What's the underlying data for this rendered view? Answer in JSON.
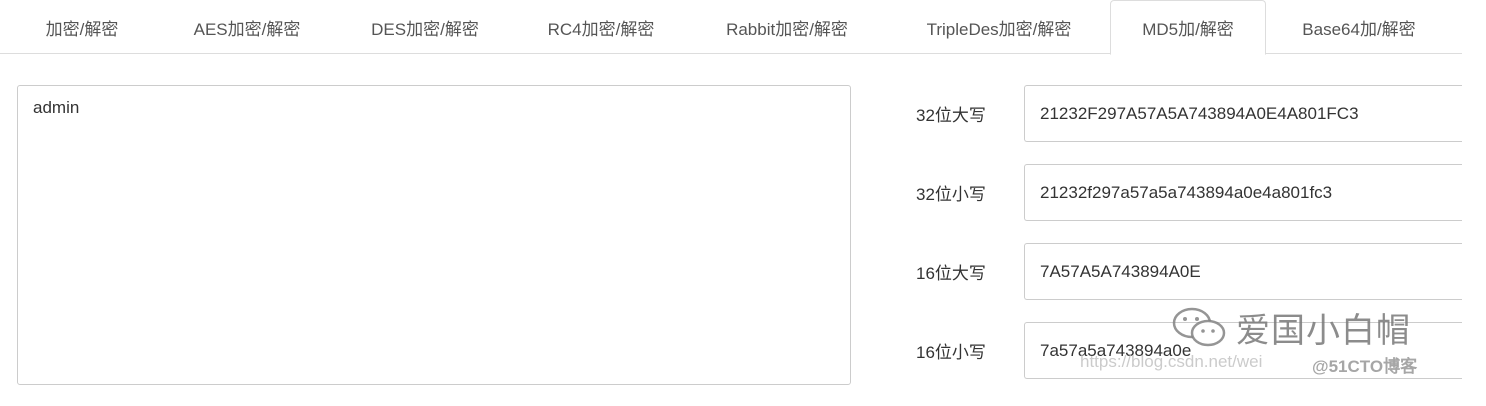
{
  "tabs": [
    {
      "label": "加密/解密"
    },
    {
      "label": "AES加密/解密"
    },
    {
      "label": "DES加密/解密"
    },
    {
      "label": "RC4加密/解密"
    },
    {
      "label": "Rabbit加密/解密"
    },
    {
      "label": "TripleDes加密/解密"
    },
    {
      "label": "MD5加/解密",
      "active": true
    },
    {
      "label": "Base64加/解密"
    }
  ],
  "input": {
    "value": "admin"
  },
  "results": [
    {
      "label": "32位大写",
      "value": "21232F297A57A5A743894A0E4A801FC3"
    },
    {
      "label": "32位小写",
      "value": "21232f297a57a5a743894a0e4a801fc3"
    },
    {
      "label": "16位大写",
      "value": "7A57A5A743894A0E"
    },
    {
      "label": "16位小写",
      "value": "7a57a5a743894a0e"
    }
  ],
  "watermark": {
    "main": "爱国小白帽",
    "url": "https://blog.csdn.net/wei",
    "site": "@51CTO博客",
    "icon": "wechat-icon"
  }
}
